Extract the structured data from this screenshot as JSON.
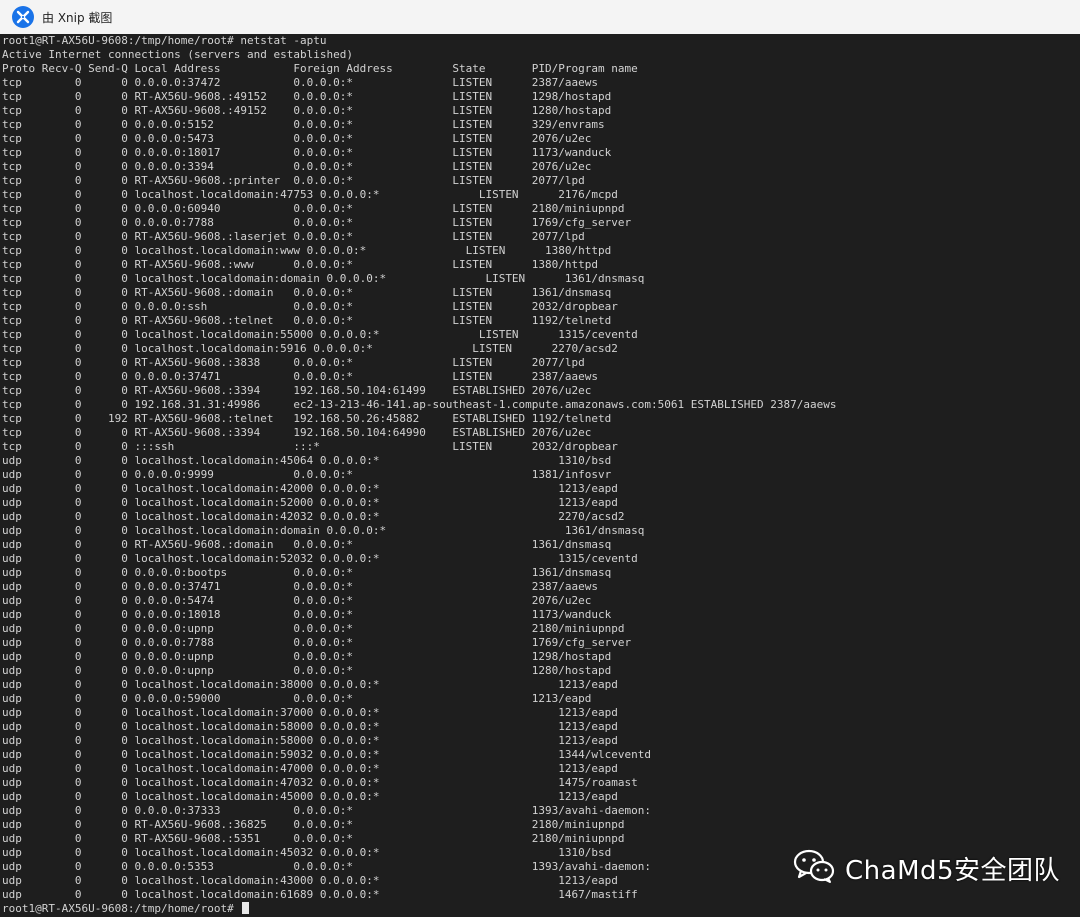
{
  "window": {
    "title": "由 Xnip 截图",
    "icon": "xnip-app-icon"
  },
  "terminal": {
    "lines": [
      "root1@RT-AX56U-9608:/tmp/home/root# netstat -aptu",
      "Active Internet connections (servers and established)",
      "Proto Recv-Q Send-Q Local Address           Foreign Address         State       PID/Program name",
      "tcp        0      0 0.0.0.0:37472           0.0.0.0:*               LISTEN      2387/aaews",
      "tcp        0      0 RT-AX56U-9608.:49152    0.0.0.0:*               LISTEN      1298/hostapd",
      "tcp        0      0 RT-AX56U-9608.:49152    0.0.0.0:*               LISTEN      1280/hostapd",
      "tcp        0      0 0.0.0.0:5152            0.0.0.0:*               LISTEN      329/envrams",
      "tcp        0      0 0.0.0.0:5473            0.0.0.0:*               LISTEN      2076/u2ec",
      "tcp        0      0 0.0.0.0:18017           0.0.0.0:*               LISTEN      1173/wanduck",
      "tcp        0      0 0.0.0.0:3394            0.0.0.0:*               LISTEN      2076/u2ec",
      "tcp        0      0 RT-AX56U-9608.:printer  0.0.0.0:*               LISTEN      2077/lpd",
      "tcp        0      0 localhost.localdomain:47753 0.0.0.0:*               LISTEN      2176/mcpd",
      "tcp        0      0 0.0.0.0:60940           0.0.0.0:*               LISTEN      2180/miniupnpd",
      "tcp        0      0 0.0.0.0:7788            0.0.0.0:*               LISTEN      1769/cfg_server",
      "tcp        0      0 RT-AX56U-9608.:laserjet 0.0.0.0:*               LISTEN      2077/lpd",
      "tcp        0      0 localhost.localdomain:www 0.0.0.0:*               LISTEN      1380/httpd",
      "tcp        0      0 RT-AX56U-9608.:www      0.0.0.0:*               LISTEN      1380/httpd",
      "tcp        0      0 localhost.localdomain:domain 0.0.0.0:*               LISTEN      1361/dnsmasq",
      "tcp        0      0 RT-AX56U-9608.:domain   0.0.0.0:*               LISTEN      1361/dnsmasq",
      "tcp        0      0 0.0.0.0:ssh             0.0.0.0:*               LISTEN      2032/dropbear",
      "tcp        0      0 RT-AX56U-9608.:telnet   0.0.0.0:*               LISTEN      1192/telnetd",
      "tcp        0      0 localhost.localdomain:55000 0.0.0.0:*               LISTEN      1315/ceventd",
      "tcp        0      0 localhost.localdomain:5916 0.0.0.0:*               LISTEN      2270/acsd2",
      "tcp        0      0 RT-AX56U-9608.:3838     0.0.0.0:*               LISTEN      2077/lpd",
      "tcp        0      0 0.0.0.0:37471           0.0.0.0:*               LISTEN      2387/aaews",
      "tcp        0      0 RT-AX56U-9608.:3394     192.168.50.104:61499    ESTABLISHED 2076/u2ec",
      "tcp        0      0 192.168.31.31:49986     ec2-13-213-46-141.ap-southeast-1.compute.amazonaws.com:5061 ESTABLISHED 2387/aaews",
      "tcp        0    192 RT-AX56U-9608.:telnet   192.168.50.26:45882     ESTABLISHED 1192/telnetd",
      "tcp        0      0 RT-AX56U-9608.:3394     192.168.50.104:64990    ESTABLISHED 2076/u2ec",
      "tcp        0      0 :::ssh                  :::*                    LISTEN      2032/dropbear",
      "udp        0      0 localhost.localdomain:45064 0.0.0.0:*                           1310/bsd",
      "udp        0      0 0.0.0.0:9999            0.0.0.0:*                           1381/infosvr",
      "udp        0      0 localhost.localdomain:42000 0.0.0.0:*                           1213/eapd",
      "udp        0      0 localhost.localdomain:52000 0.0.0.0:*                           1213/eapd",
      "udp        0      0 localhost.localdomain:42032 0.0.0.0:*                           2270/acsd2",
      "udp        0      0 localhost.localdomain:domain 0.0.0.0:*                           1361/dnsmasq",
      "udp        0      0 RT-AX56U-9608.:domain   0.0.0.0:*                           1361/dnsmasq",
      "udp        0      0 localhost.localdomain:52032 0.0.0.0:*                           1315/ceventd",
      "udp        0      0 0.0.0.0:bootps          0.0.0.0:*                           1361/dnsmasq",
      "udp        0      0 0.0.0.0:37471           0.0.0.0:*                           2387/aaews",
      "udp        0      0 0.0.0.0:5474            0.0.0.0:*                           2076/u2ec",
      "udp        0      0 0.0.0.0:18018           0.0.0.0:*                           1173/wanduck",
      "udp        0      0 0.0.0.0:upnp            0.0.0.0:*                           2180/miniupnpd",
      "udp        0      0 0.0.0.0:7788            0.0.0.0:*                           1769/cfg_server",
      "udp        0      0 0.0.0.0:upnp            0.0.0.0:*                           1298/hostapd",
      "udp        0      0 0.0.0.0:upnp            0.0.0.0:*                           1280/hostapd",
      "udp        0      0 localhost.localdomain:38000 0.0.0.0:*                           1213/eapd",
      "udp        0      0 0.0.0.0:59000           0.0.0.0:*                           1213/eapd",
      "udp        0      0 localhost.localdomain:37000 0.0.0.0:*                           1213/eapd",
      "udp        0      0 localhost.localdomain:58000 0.0.0.0:*                           1213/eapd",
      "udp        0      0 localhost.localdomain:58000 0.0.0.0:*                           1213/eapd",
      "udp        0      0 localhost.localdomain:59032 0.0.0.0:*                           1344/wlceventd",
      "udp        0      0 localhost.localdomain:47000 0.0.0.0:*                           1213/eapd",
      "udp        0      0 localhost.localdomain:47032 0.0.0.0:*                           1475/roamast",
      "udp        0      0 localhost.localdomain:45000 0.0.0.0:*                           1213/eapd",
      "udp        0      0 0.0.0.0:37333           0.0.0.0:*                           1393/avahi-daemon:",
      "udp        0      0 RT-AX56U-9608.:36825    0.0.0.0:*                           2180/miniupnpd",
      "udp        0      0 RT-AX56U-9608.:5351     0.0.0.0:*                           2180/miniupnpd",
      "udp        0      0 localhost.localdomain:45032 0.0.0.0:*                           1310/bsd",
      "udp        0      0 0.0.0.0:5353            0.0.0.0:*                           1393/avahi-daemon:",
      "udp        0      0 localhost.localdomain:43000 0.0.0.0:*                           1213/eapd",
      "udp        0      0 localhost.localdomain:61689 0.0.0.0:*                           1467/mastiff"
    ],
    "prompt": "root1@RT-AX56U-9608:/tmp/home/root# "
  },
  "watermark": {
    "text": "ChaMd5安全团队",
    "icon": "wechat-icon"
  }
}
